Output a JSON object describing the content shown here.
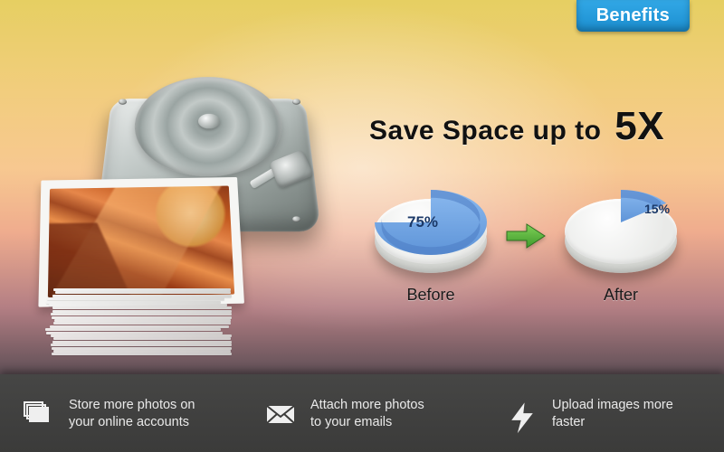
{
  "badge": {
    "label": "Benefits"
  },
  "headline": {
    "pre": "Save Space up to",
    "big": "5X"
  },
  "chart_data": {
    "type": "pie",
    "series": [
      {
        "name": "Before",
        "label": "Before",
        "used_pct": 75,
        "display": "75%"
      },
      {
        "name": "After",
        "label": "After",
        "used_pct": 15,
        "display": "15%"
      }
    ]
  },
  "arrow": {
    "name": "arrow-right"
  },
  "illustration": {
    "drive": "hard-disk-drive",
    "photo_stack": "photo-stack",
    "photo_subject": "desert-rock-canyon"
  },
  "benefits": [
    {
      "icon": "photos-stack-icon",
      "line1": "Store more photos on",
      "line2": "your online accounts"
    },
    {
      "icon": "envelope-icon",
      "line1": "Attach more photos",
      "line2": "to your emails"
    },
    {
      "icon": "lightning-icon",
      "line1": "Upload images more",
      "line2": "faster"
    }
  ],
  "colors": {
    "wedge": "#6ca5e8",
    "wedge_dark": "#456fa4",
    "badge_top": "#32a8e6",
    "badge_bot": "#1b8ed0",
    "arrow": "#4ea838"
  }
}
